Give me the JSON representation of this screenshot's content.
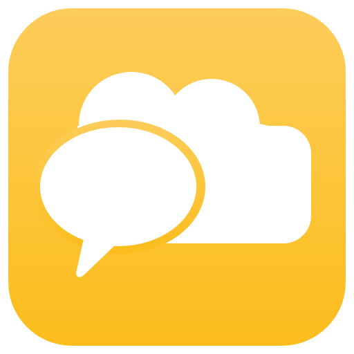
{
  "app_icon": {
    "icon": "chat-cloud-icon",
    "description_icon_parts": [
      "cloud-icon",
      "speech-bubble-icon"
    ],
    "colors": {
      "tile_top": "#FDCD5A",
      "tile_bottom": "#FBBD1C",
      "glyph": "#FFFFFF"
    }
  }
}
